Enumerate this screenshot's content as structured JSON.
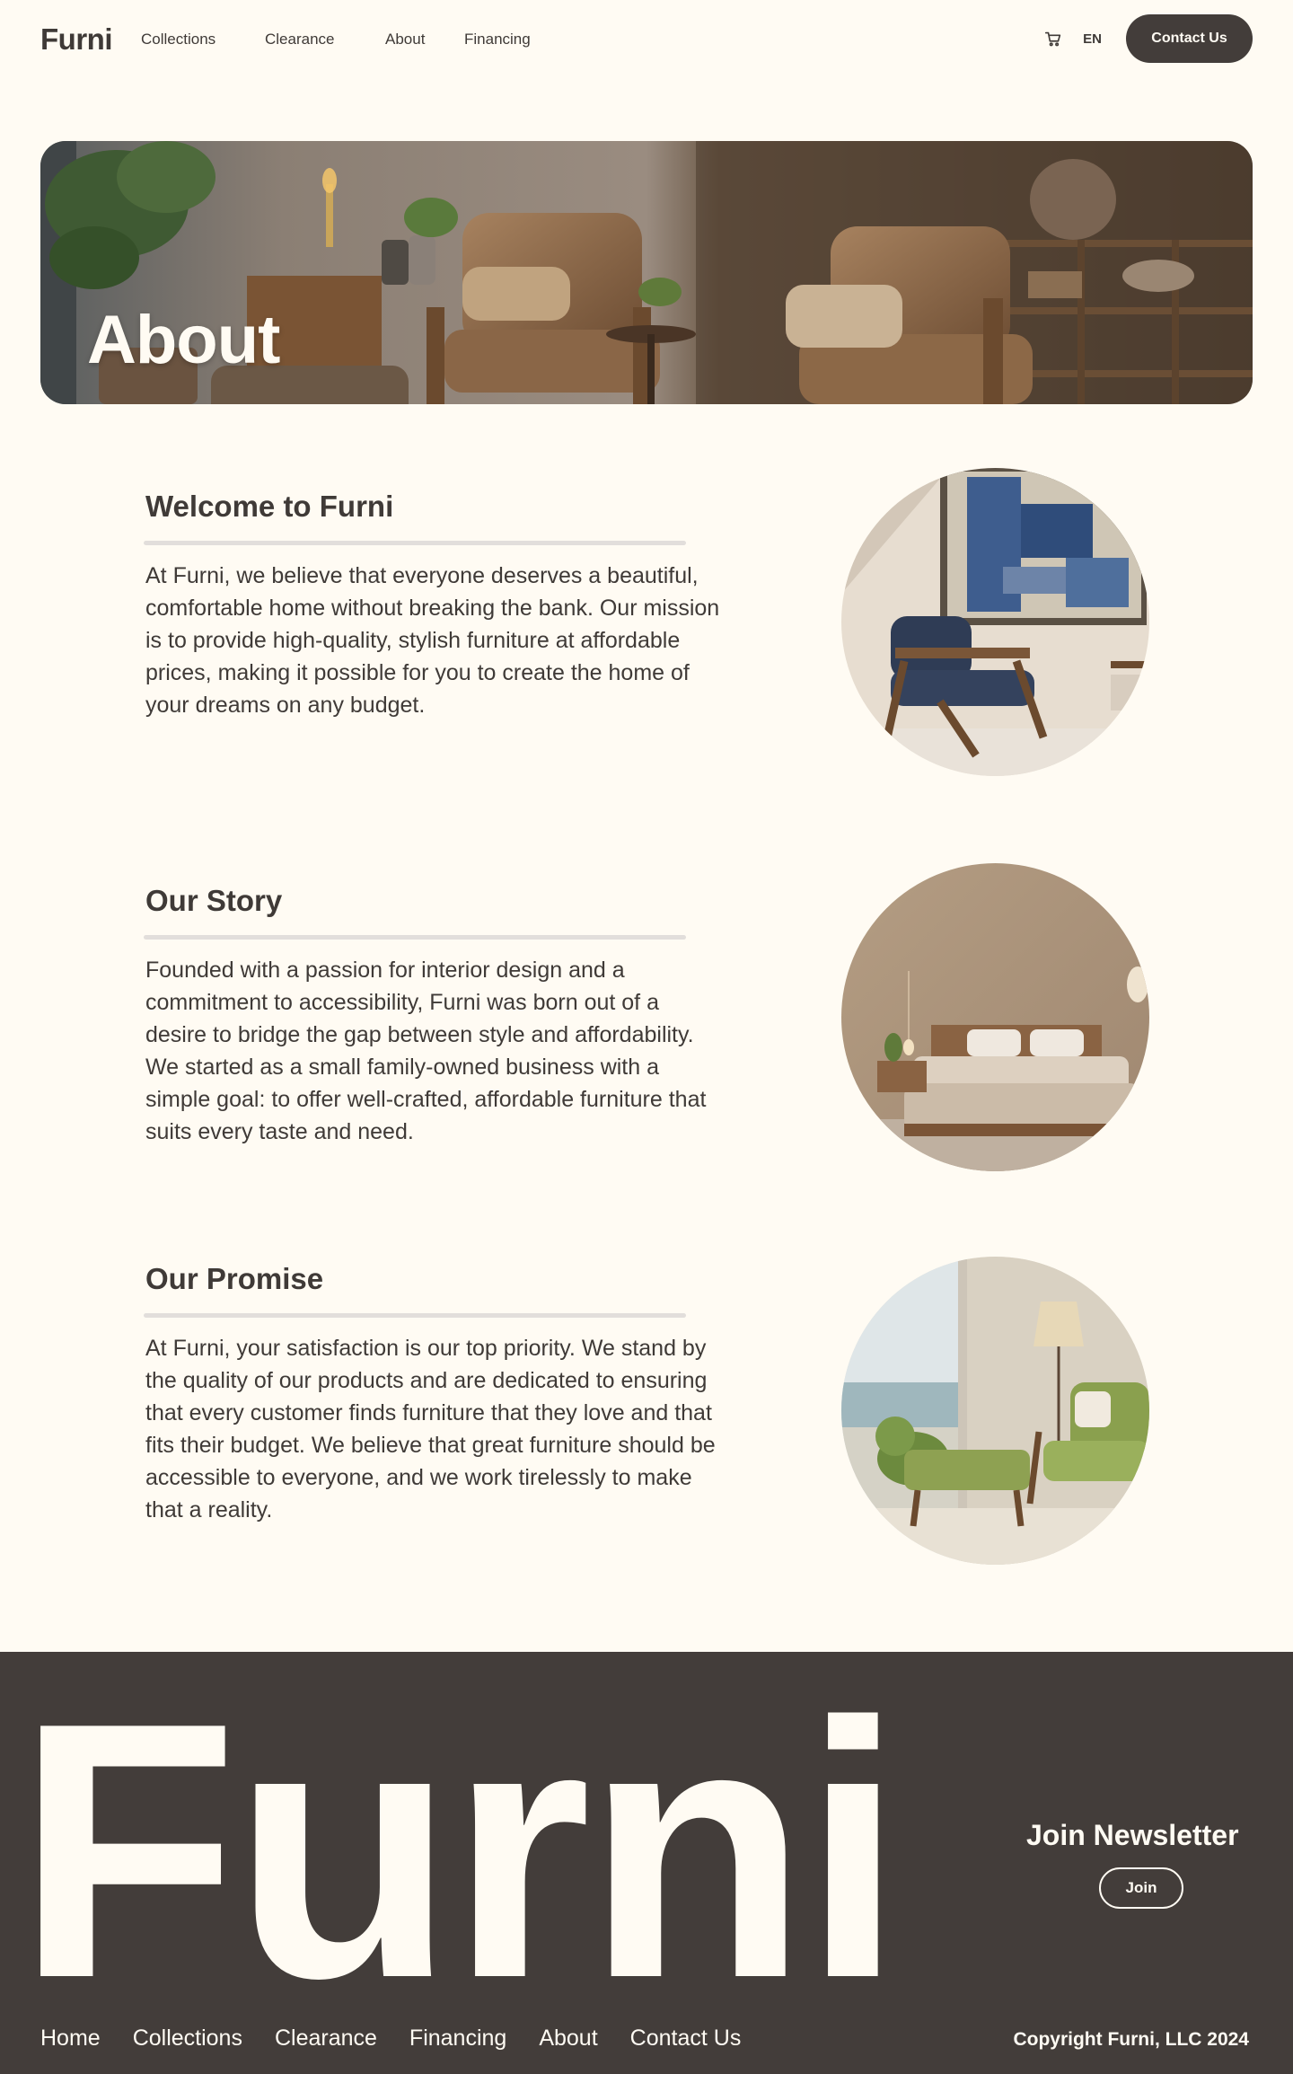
{
  "header": {
    "logo": "Furni",
    "nav": [
      "Collections",
      "Clearance",
      "About",
      "Financing"
    ],
    "language": "EN",
    "contact_label": "Contact Us",
    "cart_icon": "cart-icon"
  },
  "hero": {
    "title": "About"
  },
  "sections": [
    {
      "title": "Welcome to Furni",
      "body": "At Furni, we believe that everyone deserves a beautiful, comfortable home without breaking the bank. Our mission is to provide high-quality, stylish furniture at affordable prices, making it possible for you to create the home of your dreams on any budget."
    },
    {
      "title": "Our Story",
      "body": "Founded with a passion for interior design and a commitment to accessibility, Furni was born out of a desire to bridge the gap between style and affordability. We started as a small family-owned business with a simple goal: to offer well-crafted, affordable furniture that suits every taste and need."
    },
    {
      "title": "Our Promise",
      "body": "At Furni, your satisfaction is our top priority. We stand by the quality of our products and are dedicated to ensuring that every customer finds furniture that they love and that fits their budget. We believe that great furniture should be accessible to everyone, and we work tirelessly to make that a reality."
    }
  ],
  "footer": {
    "wordmark": "Furni",
    "newsletter_title": "Join Newsletter",
    "join_label": "Join",
    "links": [
      "Home",
      "Collections",
      "Clearance",
      "Financing",
      "About",
      "Contact Us"
    ],
    "copyright": "Copyright Furni, LLC 2024"
  },
  "colors": {
    "background": "#fffbf3",
    "primary_dark": "#433d3a",
    "divider": "#e2dedb"
  }
}
